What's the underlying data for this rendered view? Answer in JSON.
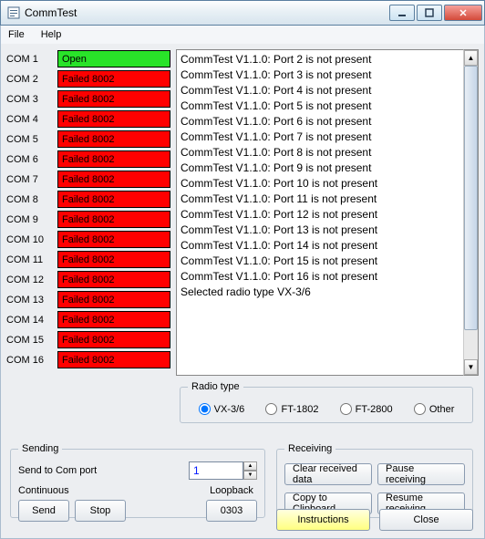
{
  "window": {
    "title": "CommTest"
  },
  "menu": {
    "file": "File",
    "help": "Help"
  },
  "ports": [
    {
      "label": "COM 1",
      "status": "Open",
      "state": "open"
    },
    {
      "label": "COM 2",
      "status": "Failed 8002",
      "state": "failed"
    },
    {
      "label": "COM 3",
      "status": "Failed 8002",
      "state": "failed"
    },
    {
      "label": "COM 4",
      "status": "Failed 8002",
      "state": "failed"
    },
    {
      "label": "COM 5",
      "status": "Failed 8002",
      "state": "failed"
    },
    {
      "label": "COM 6",
      "status": "Failed 8002",
      "state": "failed"
    },
    {
      "label": "COM 7",
      "status": "Failed 8002",
      "state": "failed"
    },
    {
      "label": "COM 8",
      "status": "Failed 8002",
      "state": "failed"
    },
    {
      "label": "COM 9",
      "status": "Failed 8002",
      "state": "failed"
    },
    {
      "label": "COM 10",
      "status": "Failed 8002",
      "state": "failed"
    },
    {
      "label": "COM 11",
      "status": "Failed 8002",
      "state": "failed"
    },
    {
      "label": "COM 12",
      "status": "Failed 8002",
      "state": "failed"
    },
    {
      "label": "COM 13",
      "status": "Failed 8002",
      "state": "failed"
    },
    {
      "label": "COM 14",
      "status": "Failed 8002",
      "state": "failed"
    },
    {
      "label": "COM 15",
      "status": "Failed 8002",
      "state": "failed"
    },
    {
      "label": "COM 16",
      "status": "Failed 8002",
      "state": "failed"
    }
  ],
  "log": [
    "CommTest V1.1.0: Port 2 is not present",
    "CommTest V1.1.0: Port 3 is not present",
    "CommTest V1.1.0: Port 4 is not present",
    "CommTest V1.1.0: Port 5 is not present",
    "CommTest V1.1.0: Port 6 is not present",
    "CommTest V1.1.0: Port 7 is not present",
    "CommTest V1.1.0: Port 8 is not present",
    "CommTest V1.1.0: Port 9 is not present",
    "CommTest V1.1.0: Port 10 is not present",
    "CommTest V1.1.0: Port 11 is not present",
    "CommTest V1.1.0: Port 12 is not present",
    "CommTest V1.1.0: Port 13 is not present",
    "CommTest V1.1.0: Port 14 is not present",
    "CommTest V1.1.0: Port 15 is not present",
    "CommTest V1.1.0: Port 16 is not present",
    "Selected radio type VX-3/6"
  ],
  "radio": {
    "legend": "Radio type",
    "options": [
      {
        "label": "VX-3/6",
        "checked": true
      },
      {
        "label": "FT-1802",
        "checked": false
      },
      {
        "label": "FT-2800",
        "checked": false
      },
      {
        "label": "Other",
        "checked": false
      }
    ]
  },
  "sending": {
    "legend": "Sending",
    "sendto": "Send to Com port",
    "port_value": "1",
    "continuous": "Continuous",
    "send": "Send",
    "stop": "Stop",
    "loopback": "Loopback",
    "loopback_btn": "0303"
  },
  "receiving": {
    "legend": "Receiving",
    "clear": "Clear received data",
    "pause": "Pause receiving",
    "copy": "Copy to Clipboard",
    "resume": "Resume receiving"
  },
  "bottom": {
    "instructions": "Instructions",
    "close": "Close"
  }
}
